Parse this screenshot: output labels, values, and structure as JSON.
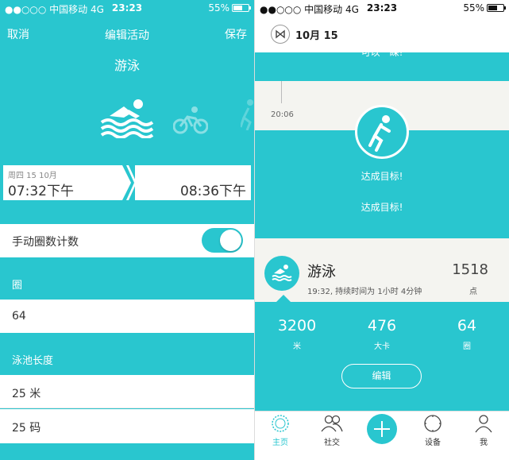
{
  "status_left": {
    "carrier": "●●○○○ 中国移动  4G",
    "time": "23:23",
    "battery": "55%",
    "battery_level": 0.55
  },
  "status_right": {
    "carrier": "●●○○○ 中国移动  4G",
    "time": "23:23",
    "battery": "55%",
    "battery_level": 0.55
  },
  "edit": {
    "cancel_label": "取消",
    "title": "编辑活动",
    "save_label": "保存",
    "activity_name": "游泳",
    "icons": [
      "swimming-icon",
      "cycling-icon",
      "running-icon"
    ],
    "start": {
      "date": "周四 15 10月",
      "time": "07:32下午"
    },
    "end": {
      "time": "08:36下午"
    },
    "manual_laps_label": "手动圈数计数",
    "manual_laps_on": true,
    "laps_label": "圈",
    "laps_value": "64",
    "pool_length_label": "泳池长度",
    "pool_options": [
      "25 米",
      "25 码"
    ]
  },
  "feed": {
    "date_label": "10月 15",
    "truncated_text": "可以一睬!",
    "timeline_time": "20:06",
    "goal_icon": "running-icon",
    "goal_text_1": "达成目标!",
    "goal_text_2": "达成目标!",
    "card": {
      "icon": "swimming-icon",
      "title": "游泳",
      "subtitle": "19:32, 持续时间为 1小时 4分钟",
      "points": "1518",
      "points_unit": "点"
    },
    "stats": [
      {
        "value": "3200",
        "unit": "米"
      },
      {
        "value": "476",
        "unit": "大卡"
      },
      {
        "value": "64",
        "unit": "圈"
      }
    ],
    "edit_label": "编辑"
  },
  "tabs": [
    {
      "label": "主页",
      "icon": "home-ring-icon",
      "active": true
    },
    {
      "label": "社交",
      "icon": "people-icon",
      "active": false
    },
    {
      "label": "",
      "icon": "plus-icon",
      "active": false
    },
    {
      "label": "设备",
      "icon": "watch-icon",
      "active": false
    },
    {
      "label": "我",
      "icon": "person-icon",
      "active": false
    }
  ],
  "colors": {
    "accent": "#29c6cf",
    "background_light": "#f4f4f0",
    "text_dark": "#333333"
  }
}
